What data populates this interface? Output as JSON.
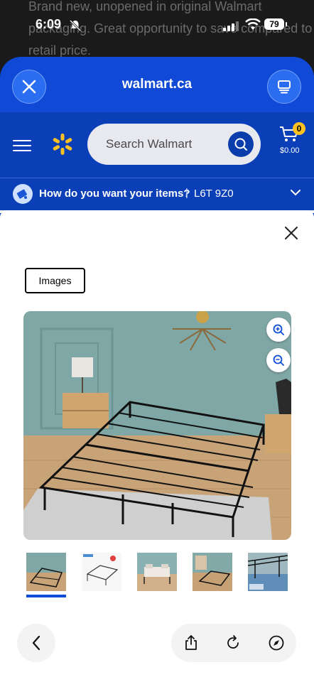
{
  "background": {
    "text": "Brand new, unopened in original Walmart packaging. Great opportunity to save compared to retail price."
  },
  "status": {
    "time": "6:09",
    "battery": "79"
  },
  "browser": {
    "url": "walmart.ca",
    "close_icon": "close-icon",
    "tabs_icon": "tabs-icon"
  },
  "header": {
    "search_placeholder": "Search Walmart",
    "cart_count": "0",
    "cart_total": "$0.00",
    "brand_color": "#0a3fb8",
    "spark_color": "#ffc220"
  },
  "delivery": {
    "question": "How do you want your items?",
    "separator": "|",
    "postal_code": "L6T 9Z0"
  },
  "modal": {
    "images_button": "Images",
    "zoom_in_icon": "zoom-in-icon",
    "zoom_out_icon": "zoom-out-icon",
    "thumbnails": [
      {
        "name": "bed-room-photo",
        "selected": true
      },
      {
        "name": "bed-dimensions-diagram",
        "selected": false
      },
      {
        "name": "bed-with-mattress",
        "selected": false
      },
      {
        "name": "bed-alternate-room",
        "selected": false
      },
      {
        "name": "bed-underbed-storage",
        "selected": false
      }
    ]
  },
  "bottom_bar": {
    "back_icon": "back-chevron-icon",
    "share_icon": "share-icon",
    "reload_icon": "reload-icon",
    "compass_icon": "compass-icon"
  }
}
